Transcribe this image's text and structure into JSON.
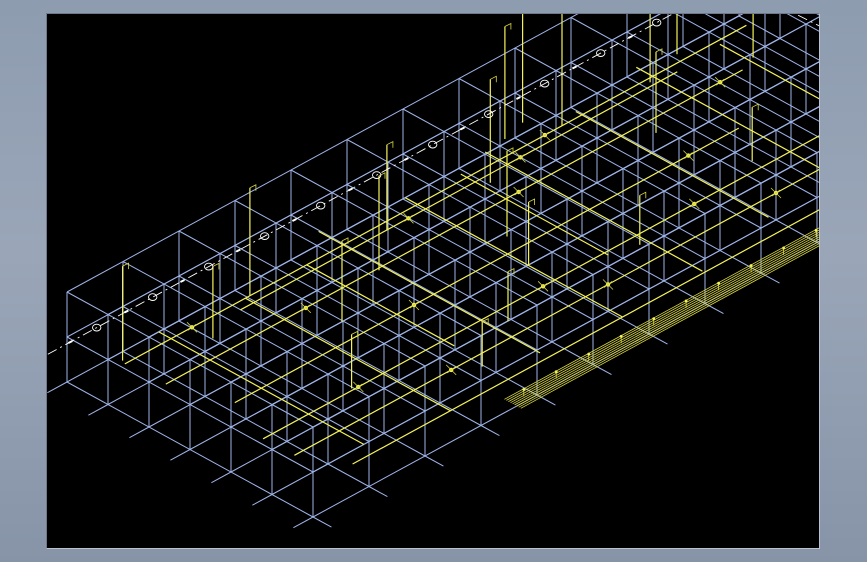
{
  "app": {
    "window_background": "#8e9cb0",
    "viewport_background": "#000000"
  },
  "drawing": {
    "kind": "isometric wireframe",
    "colors": {
      "structural_grid": "#9fb4e8",
      "piping": "#f4f25a",
      "axis_markers": "#ffffff"
    }
  }
}
